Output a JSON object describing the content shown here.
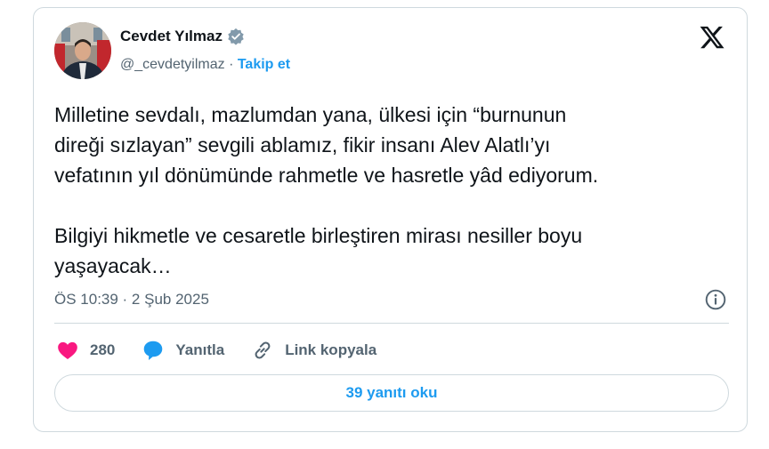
{
  "author": {
    "name": "Cevdet Yılmaz",
    "handle": "@_cevdetyilmaz",
    "separator": " · ",
    "follow_label": "Takip et"
  },
  "tweet": {
    "text": "Milletine sevdalı, mazlumdan yana, ülkesi için “burnunun\ndireği sızlayan” sevgili ablamız, fikir insanı Alev Alatlı’yı\nvefatının yıl dönümünde rahmetle ve hasretle yâd ediyorum.\n\nBilgiyi hikmetle ve cesaretle birleştiren mirası nesiller boyu\nyaşayacak…",
    "timestamp": "ÖS 10:39 · 2 Şub 2025"
  },
  "actions": {
    "likes": "280",
    "reply_label": "Yanıtla",
    "copy_link_label": "Link kopyala"
  },
  "read_replies_label": "39 yanıtı oku",
  "colors": {
    "accent": "#1d9bf0",
    "like": "#f91880",
    "text": "#0f1419",
    "muted": "#536471",
    "border": "#cfd9de"
  },
  "icons": [
    "verified-badge-icon",
    "x-logo-icon",
    "info-icon",
    "heart-icon",
    "reply-bubble-icon",
    "link-icon"
  ]
}
